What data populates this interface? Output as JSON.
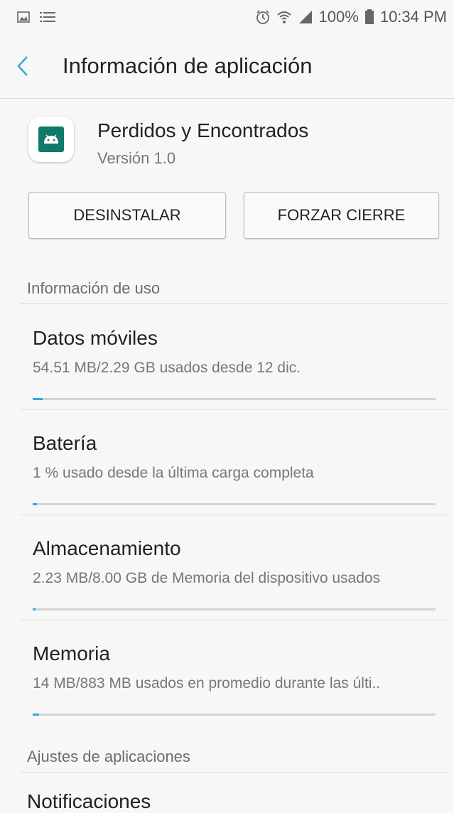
{
  "status_bar": {
    "battery": "100%",
    "time": "10:34 PM",
    "icons": [
      "image-icon",
      "list-icon",
      "alarm-icon",
      "wifi-icon",
      "signal-icon",
      "battery-icon"
    ]
  },
  "header": {
    "title": "Información de aplicación",
    "back_icon": "chevron-left-icon"
  },
  "app": {
    "name": "Perdidos y Encontrados",
    "version": "Versión 1.0",
    "icon": "android-icon",
    "icon_color": "#0f7a6a"
  },
  "buttons": {
    "uninstall": "DESINSTALAR",
    "force_stop": "FORZAR CIERRE"
  },
  "usage_section": {
    "header": "Información de uso",
    "items": [
      {
        "title": "Datos móviles",
        "subtitle": "54.51 MB/2.29 GB usados desde 12 dic.",
        "progress": 0.024
      },
      {
        "title": "Batería",
        "subtitle": "1 % usado desde la última carga completa",
        "progress": 0.01
      },
      {
        "title": "Almacenamiento",
        "subtitle": "2.23 MB/8.00 GB de Memoria del dispositivo usados",
        "progress": 0.0003
      },
      {
        "title": "Memoria",
        "subtitle": "14 MB/883 MB usados en promedio durante las últi..",
        "progress": 0.016
      }
    ]
  },
  "settings_section": {
    "header": "Ajustes de aplicaciones",
    "first_item": "Notificaciones"
  },
  "colors": {
    "accent": "#3aa5db",
    "background": "#f7f7f7"
  }
}
